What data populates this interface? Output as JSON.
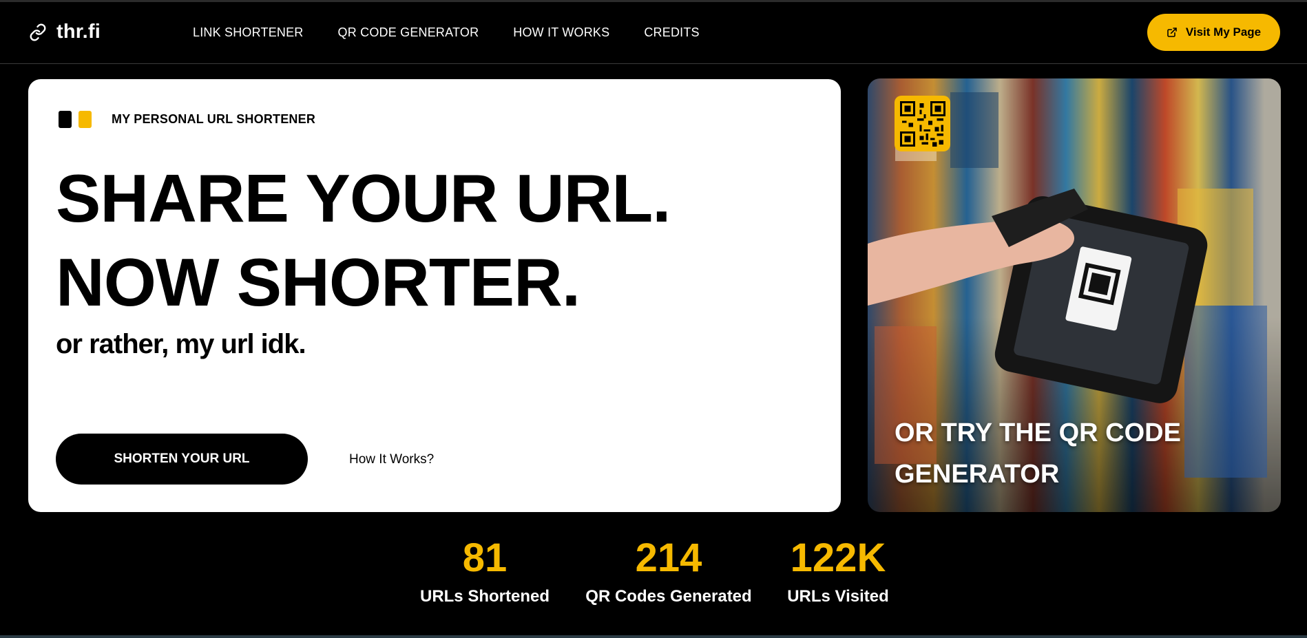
{
  "brand": {
    "name": "thr.fi",
    "icon": "link-icon"
  },
  "nav": {
    "links": [
      {
        "label": "LINK SHORTENER"
      },
      {
        "label": "QR CODE GENERATOR"
      },
      {
        "label": "HOW IT WORKS"
      },
      {
        "label": "CREDITS"
      }
    ],
    "cta": {
      "label": "Visit My Page",
      "icon": "external-link-icon"
    }
  },
  "hero": {
    "kicker": "MY PERSONAL URL SHORTENER",
    "headline_line1": "SHARE YOUR URL.",
    "headline_line2": "NOW SHORTER.",
    "subline": "or rather, my url idk.",
    "primary_button": "SHORTEN YOUR URL",
    "secondary_link": "How It Works?"
  },
  "promo": {
    "title": "OR TRY THE QR CODE GENERATOR",
    "badge_icon": "qr-code-icon"
  },
  "stats": [
    {
      "value": "81",
      "label": "URLs Shortened"
    },
    {
      "value": "214",
      "label": "QR Codes Generated"
    },
    {
      "value": "122K",
      "label": "URLs Visited"
    }
  ],
  "colors": {
    "accent": "#f6b900",
    "background": "#000000",
    "card": "#ffffff"
  }
}
